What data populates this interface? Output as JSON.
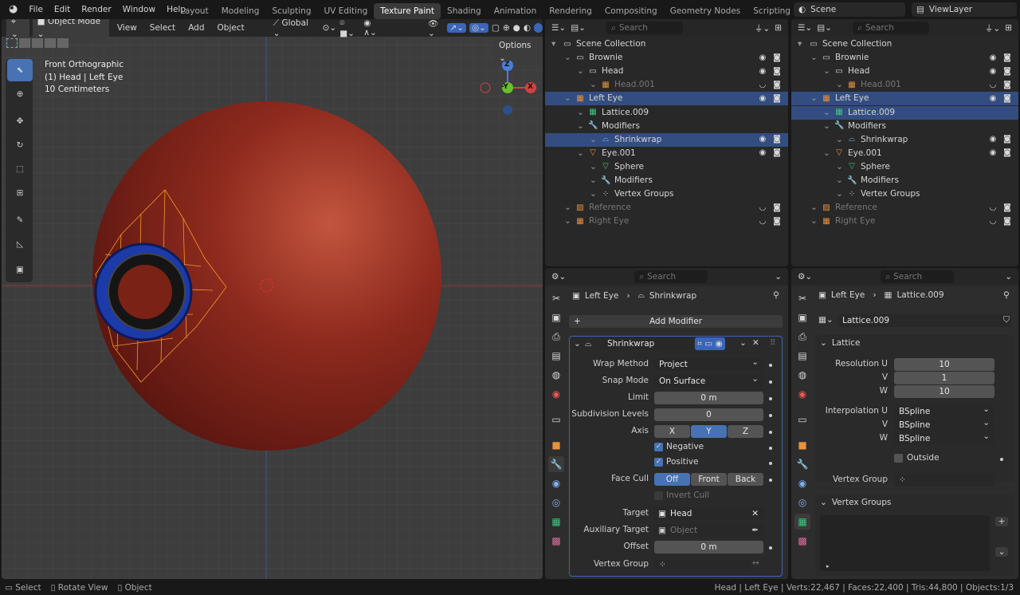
{
  "menu": {
    "items": [
      "File",
      "Edit",
      "Render",
      "Window",
      "Help"
    ]
  },
  "workspaces": [
    "Layout",
    "Modeling",
    "Sculpting",
    "UV Editing",
    "Texture Paint",
    "Shading",
    "Animation",
    "Rendering",
    "Compositing",
    "Geometry Nodes",
    "Scripting"
  ],
  "active_workspace": "Texture Paint",
  "scene": "Scene",
  "view_layer": "ViewLayer",
  "viewport": {
    "mode": "Object Mode",
    "menus": [
      "View",
      "Select",
      "Add",
      "Object"
    ],
    "orientation": "Global",
    "options": "Options",
    "info": [
      "Front Orthographic",
      "(1) Head | Left Eye",
      "10 Centimeters"
    ],
    "gizmo": {
      "z": "Z",
      "y": "-Y",
      "x": "X"
    }
  },
  "outliner_left": {
    "search": "Search",
    "rows": [
      {
        "label": "Scene Collection",
        "indent": 0,
        "icon": "collection-icon"
      },
      {
        "label": "Brownie",
        "indent": 1,
        "icon": "collection-icon"
      },
      {
        "label": "Head",
        "indent": 2,
        "icon": "collection-icon"
      },
      {
        "label": "Head.001",
        "indent": 3,
        "icon": "lattice-icon",
        "dim": true
      },
      {
        "label": "Left Eye",
        "indent": 1,
        "icon": "lattice-icon",
        "sel": true
      },
      {
        "label": "Lattice.009",
        "indent": 2,
        "icon": "lattice-data-icon"
      },
      {
        "label": "Modifiers",
        "indent": 2,
        "icon": "wrench-icon"
      },
      {
        "label": "Shrinkwrap",
        "indent": 3,
        "icon": "shrinkwrap-icon",
        "sel2": true
      },
      {
        "label": "Eye.001",
        "indent": 2,
        "icon": "mesh-icon"
      },
      {
        "label": "Sphere",
        "indent": 3,
        "icon": "mesh-data-icon"
      },
      {
        "label": "Modifiers",
        "indent": 3,
        "icon": "wrench-icon"
      },
      {
        "label": "Vertex Groups",
        "indent": 3,
        "icon": "vertex-groups-icon"
      },
      {
        "label": "Reference",
        "indent": 1,
        "icon": "image-icon",
        "dim": true
      },
      {
        "label": "Right Eye",
        "indent": 1,
        "icon": "lattice-icon",
        "dim": true
      }
    ]
  },
  "outliner_right": {
    "search": "Search",
    "rows": [
      {
        "label": "Scene Collection",
        "indent": 0,
        "icon": "collection-icon"
      },
      {
        "label": "Brownie",
        "indent": 1,
        "icon": "collection-icon"
      },
      {
        "label": "Head",
        "indent": 2,
        "icon": "collection-icon"
      },
      {
        "label": "Head.001",
        "indent": 3,
        "icon": "lattice-icon",
        "dim": true
      },
      {
        "label": "Left Eye",
        "indent": 1,
        "icon": "lattice-icon",
        "sel": true
      },
      {
        "label": "Lattice.009",
        "indent": 2,
        "icon": "lattice-data-icon",
        "sel2": true
      },
      {
        "label": "Modifiers",
        "indent": 2,
        "icon": "wrench-icon"
      },
      {
        "label": "Shrinkwrap",
        "indent": 3,
        "icon": "shrinkwrap-icon"
      },
      {
        "label": "Eye.001",
        "indent": 2,
        "icon": "mesh-icon"
      },
      {
        "label": "Sphere",
        "indent": 3,
        "icon": "mesh-data-icon"
      },
      {
        "label": "Modifiers",
        "indent": 3,
        "icon": "wrench-icon"
      },
      {
        "label": "Vertex Groups",
        "indent": 3,
        "icon": "vertex-groups-icon"
      },
      {
        "label": "Reference",
        "indent": 1,
        "icon": "image-icon",
        "dim": true
      },
      {
        "label": "Right Eye",
        "indent": 1,
        "icon": "lattice-icon",
        "dim": true
      }
    ]
  },
  "props_mod": {
    "search": "Search",
    "crumb_obj": "Left Eye",
    "crumb_mod": "Shrinkwrap",
    "add_modifier": "Add Modifier",
    "mod_name": "Shrinkwrap",
    "wrap_method_label": "Wrap Method",
    "wrap_method": "Project",
    "snap_mode_label": "Snap Mode",
    "snap_mode": "On Surface",
    "limit_label": "Limit",
    "limit": "0 m",
    "subdiv_label": "Subdivision Levels",
    "subdiv": "0",
    "axis_label": "Axis",
    "axes": [
      "X",
      "Y",
      "Z"
    ],
    "axis_active": "Y",
    "negative": "Negative",
    "positive": "Positive",
    "face_cull_label": "Face Cull",
    "face_cull": [
      "Off",
      "Front",
      "Back"
    ],
    "face_cull_active": "Off",
    "invert_cull": "Invert Cull",
    "target_label": "Target",
    "target": "Head",
    "aux_target_label": "Auxiliary Target",
    "aux_target_placeholder": "Object",
    "offset_label": "Offset",
    "offset": "0 m",
    "vertex_group_label": "Vertex Group"
  },
  "props_lat": {
    "search": "Search",
    "crumb_obj": "Left Eye",
    "crumb_data": "Lattice.009",
    "data_name": "Lattice.009",
    "section": "Lattice",
    "res_u_label": "Resolution U",
    "res_u": "10",
    "v_label": "V",
    "res_v": "1",
    "w_label": "W",
    "res_w": "10",
    "interp_u_label": "Interpolation U",
    "interp_u": "BSpline",
    "interp_v": "BSpline",
    "interp_w": "BSpline",
    "outside": "Outside",
    "vertex_group_label": "Vertex Group",
    "vertex_groups_section": "Vertex Groups"
  },
  "status": {
    "hints": [
      "Select",
      "Rotate View",
      "Object"
    ],
    "stats": "Head | Left Eye | Verts:22,467 | Faces:22,400 | Tris:44,800 | Objects:1/3"
  }
}
